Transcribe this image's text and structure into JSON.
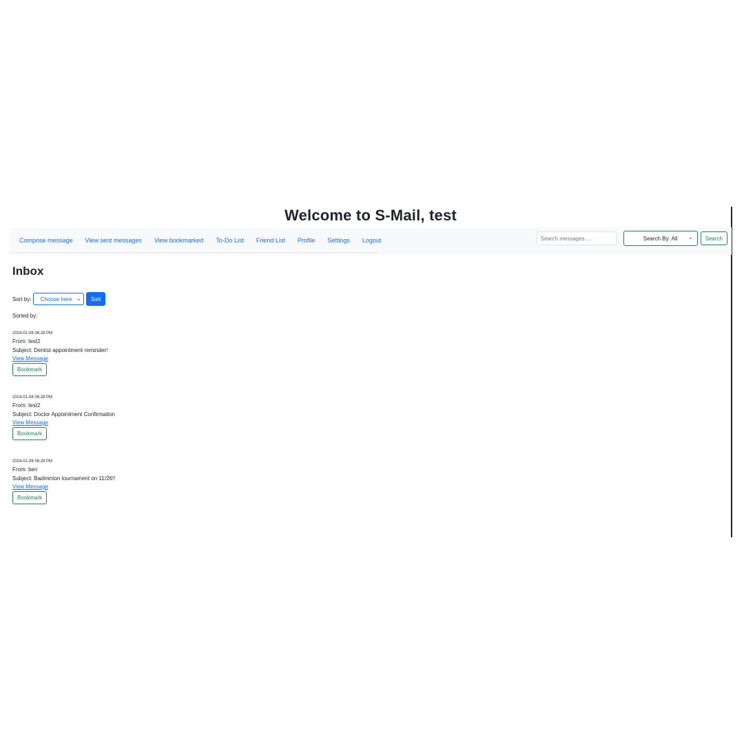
{
  "header": {
    "title": "Welcome to S-Mail, test"
  },
  "nav": {
    "items": [
      {
        "label": "Compose message"
      },
      {
        "label": "View sent messages"
      },
      {
        "label": "View bookmarked"
      },
      {
        "label": "To-Do List"
      },
      {
        "label": "Friend List"
      },
      {
        "label": "Profile"
      },
      {
        "label": "Settings"
      },
      {
        "label": "Logout"
      }
    ]
  },
  "search": {
    "placeholder": "Search messages ...",
    "select_value": "Search By: All",
    "button_label": "Search"
  },
  "inbox": {
    "heading": "Inbox",
    "sort_label": "Sort by:",
    "sort_select_value": "Choose here",
    "sort_button_label": "Sort",
    "sorted_by_label": "Sorted by:"
  },
  "messages": [
    {
      "timestamp": "2024-01-08 06:28 PM",
      "from": "From: test2",
      "subject": "Subject: Dentist appointment reminder!",
      "view_label": "View Message",
      "bookmark_label": "Bookmark"
    },
    {
      "timestamp": "2024-01-08 06:28 PM",
      "from": "From: test2",
      "subject": "Subject: Doctor Appointment Confirmation",
      "view_label": "View Message",
      "bookmark_label": "Bookmark"
    },
    {
      "timestamp": "2024-01-08 06:29 PM",
      "from": "From: ben",
      "subject": "Subject: Badminton tournament on 11/26!!",
      "view_label": "View Message",
      "bookmark_label": "Bookmark"
    }
  ],
  "colors": {
    "link": "#0d6efd",
    "success": "#198754",
    "navbar_bg": "#f8f9fa"
  },
  "icons": {
    "select_chevron": "chevron-down-icon"
  }
}
